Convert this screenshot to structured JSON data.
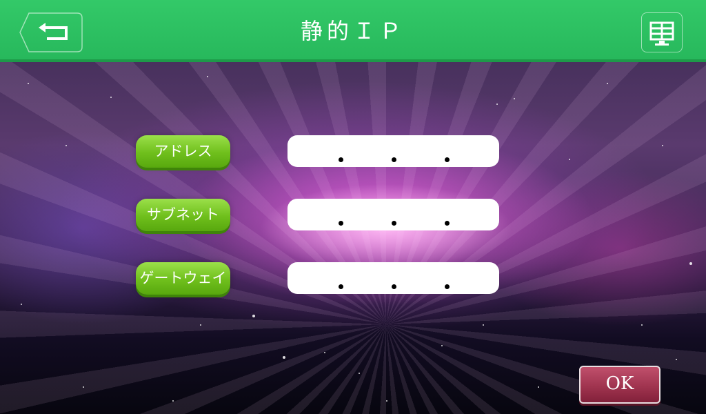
{
  "header": {
    "title": "静的ＩＰ",
    "back_icon": "back-arrow-icon",
    "menu_icon": "grid-monitor-icon"
  },
  "form": {
    "rows": [
      {
        "label": "アドレス",
        "value": "",
        "separators": [
          ".",
          ".",
          "."
        ]
      },
      {
        "label": "サブネット",
        "value": "",
        "separators": [
          ".",
          ".",
          "."
        ]
      },
      {
        "label": "ゲートウェイ",
        "value": "",
        "separators": [
          ".",
          ".",
          "."
        ]
      }
    ]
  },
  "footer": {
    "ok_label": "OK"
  },
  "colors": {
    "header": "#2bbb5e",
    "label_button": "#7ac623",
    "ok_button": "#a3364f",
    "field": "#ffffff"
  }
}
